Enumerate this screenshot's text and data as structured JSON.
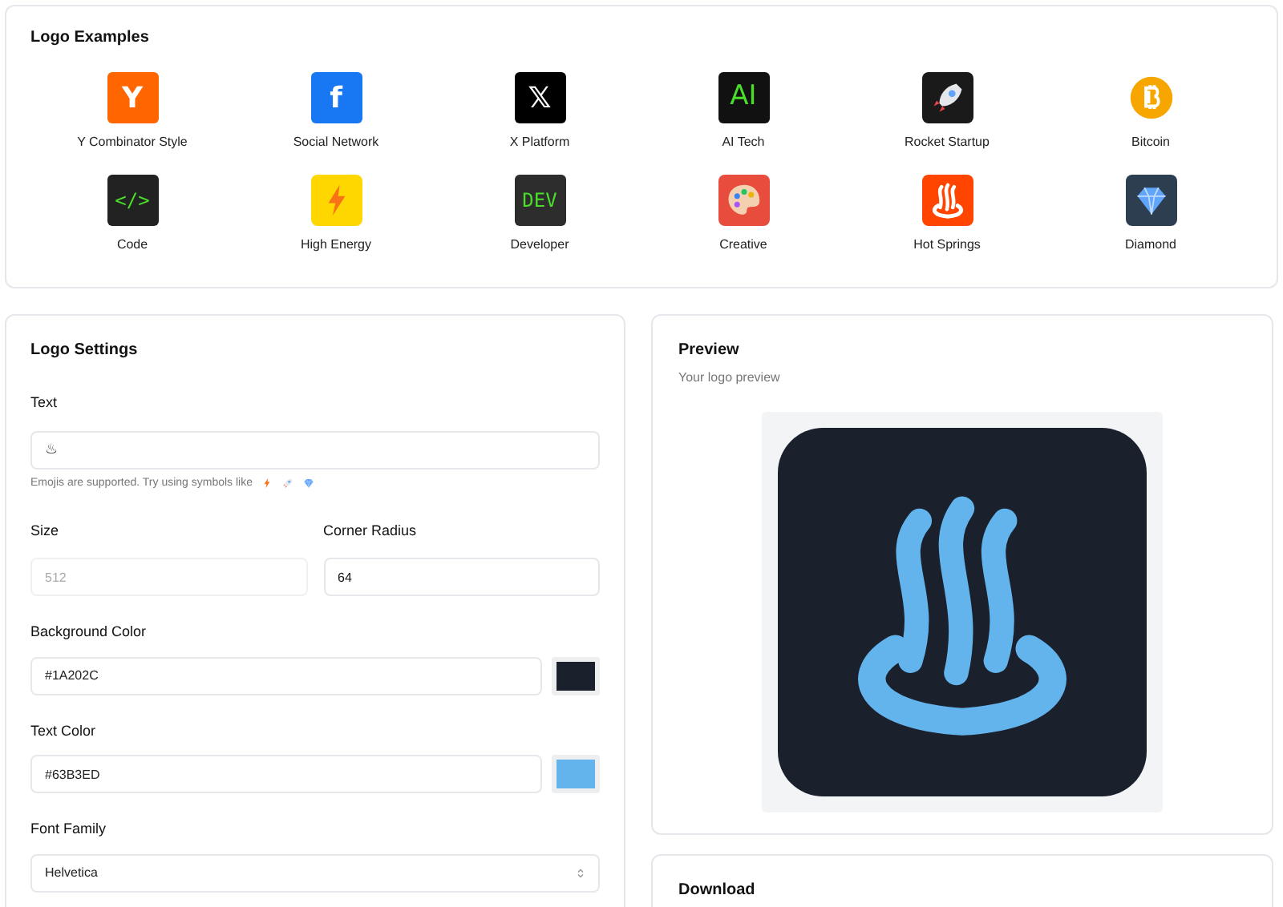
{
  "examples": {
    "title": "Logo Examples",
    "items": [
      {
        "label": "Y Combinator Style",
        "kind": "text",
        "glyph": "Y",
        "color": "#ff6600"
      },
      {
        "label": "Social Network",
        "kind": "text",
        "glyph": "f",
        "color": "#1877f2"
      },
      {
        "label": "X Platform",
        "kind": "text",
        "glyph": "𝕏",
        "color": "#000000"
      },
      {
        "label": "AI Tech",
        "kind": "code",
        "glyph": "AI",
        "color": "#111111"
      },
      {
        "label": "Rocket Startup",
        "kind": "rocket",
        "color": "#1a1a1a"
      },
      {
        "label": "Bitcoin",
        "kind": "bitcoin",
        "color": "#ffffff"
      },
      {
        "label": "Code",
        "kind": "code",
        "glyph": "</>",
        "color": "#222222"
      },
      {
        "label": "High Energy",
        "kind": "bolt",
        "color": "#ffd700"
      },
      {
        "label": "Developer",
        "kind": "code",
        "glyph": "DEV",
        "color": "#2d2d2d"
      },
      {
        "label": "Creative",
        "kind": "palette",
        "color": "#e74c3c"
      },
      {
        "label": "Hot Springs",
        "kind": "springs",
        "color": "#ff4500"
      },
      {
        "label": "Diamond",
        "kind": "diamond",
        "color": "#2c3e50"
      }
    ]
  },
  "settings": {
    "title": "Logo Settings",
    "text": {
      "label": "Text",
      "value": "♨",
      "hint": "Emojis are supported. Try using symbols like"
    },
    "size": {
      "label": "Size",
      "placeholder": "512"
    },
    "radius": {
      "label": "Corner Radius",
      "value": "64"
    },
    "background": {
      "label": "Background Color",
      "value": "#1A202C",
      "color": "#1a202c"
    },
    "text_color": {
      "label": "Text Color",
      "value": "#63B3ED",
      "color": "#63b3ed"
    },
    "font": {
      "label": "Font Family",
      "value": "Helvetica"
    }
  },
  "preview": {
    "title": "Preview",
    "subtitle": "Your logo preview"
  },
  "download": {
    "title": "Download"
  }
}
